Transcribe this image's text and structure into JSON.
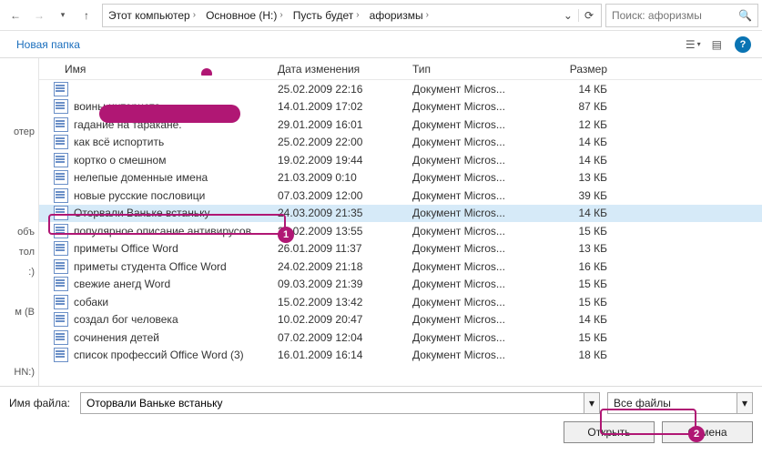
{
  "breadcrumbs": [
    "Этот компьютер",
    "Основное (H:)",
    "Пусть будет",
    "афоризмы"
  ],
  "search_placeholder": "Поиск: афоризмы",
  "new_folder": "Новая папка",
  "columns": {
    "name": "Имя",
    "date": "Дата изменения",
    "type": "Тип",
    "size": "Размер"
  },
  "files": [
    {
      "name": "",
      "date": "25.02.2009 22:16",
      "type": "Документ Micros...",
      "size": "14 КБ"
    },
    {
      "name": "воины интернета",
      "date": "14.01.2009 17:02",
      "type": "Документ Micros...",
      "size": "87 КБ"
    },
    {
      "name": "гадание на таракане.",
      "date": "29.01.2009 16:01",
      "type": "Документ Micros...",
      "size": "12 КБ"
    },
    {
      "name": "как всё испортить",
      "date": "25.02.2009 22:00",
      "type": "Документ Micros...",
      "size": "14 КБ"
    },
    {
      "name": "кортко о смешном",
      "date": "19.02.2009 19:44",
      "type": "Документ Micros...",
      "size": "14 КБ"
    },
    {
      "name": "нелепые доменные имена",
      "date": "21.03.2009 0:10",
      "type": "Документ Micros...",
      "size": "13 КБ"
    },
    {
      "name": "новые русские пословици",
      "date": "07.03.2009 12:00",
      "type": "Документ Micros...",
      "size": "39 КБ"
    },
    {
      "name": "Оторвали Ваньке встаньку",
      "date": "24.03.2009 21:35",
      "type": "Документ Micros...",
      "size": "14 КБ",
      "selected": true
    },
    {
      "name": "популярное описание антивирусов",
      "date": "28.02.2009 13:55",
      "type": "Документ Micros...",
      "size": "15 КБ"
    },
    {
      "name": "приметы Office Word",
      "date": "26.01.2009 11:37",
      "type": "Документ Micros...",
      "size": "13 КБ"
    },
    {
      "name": "приметы студента Office Word",
      "date": "24.02.2009 21:18",
      "type": "Документ Micros...",
      "size": "16 КБ"
    },
    {
      "name": "свежие анегд Word",
      "date": "09.03.2009 21:39",
      "type": "Документ Micros...",
      "size": "15 КБ"
    },
    {
      "name": "собаки",
      "date": "15.02.2009 13:42",
      "type": "Документ Micros...",
      "size": "15 КБ"
    },
    {
      "name": "создал бог человека",
      "date": "10.02.2009 20:47",
      "type": "Документ Micros...",
      "size": "14 КБ"
    },
    {
      "name": "сочинения детей",
      "date": "07.02.2009 12:04",
      "type": "Документ Micros...",
      "size": "15 КБ"
    },
    {
      "name": "список профессий Office Word (3)",
      "date": "16.01.2009 16:14",
      "type": "Документ Micros...",
      "size": "18 КБ"
    }
  ],
  "nav_items": [
    "",
    "",
    "",
    "отер",
    "",
    "",
    "",
    "",
    "объ",
    "тол",
    ":)",
    "",
    "м (В",
    "",
    "",
    "HN:)"
  ],
  "filename_label": "Имя файла:",
  "filename_value": "Оторвали Ваньке встаньку",
  "filter_label": "Все файлы",
  "open_btn": "Открыть",
  "cancel_btn": "Отмена",
  "markers": {
    "m1": "1",
    "m2": "2"
  }
}
